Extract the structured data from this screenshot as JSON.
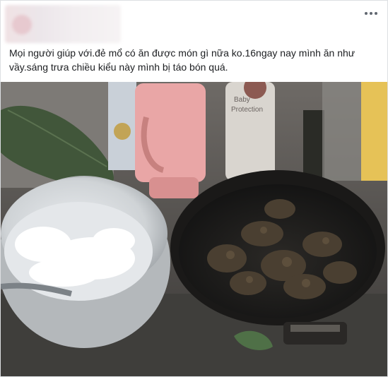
{
  "post": {
    "author_name": "",
    "text": "Mọi người giúp với.đẻ mổ có ăn được món gì nữa ko.16ngay nay mình ăn như vầy.sáng trưa chiều kiểu này mình bị táo bón quá.",
    "menu_icon": "more-horizontal-icon",
    "photo": {
      "description_icon": "food-photo",
      "bottle_label_line1": "Baby",
      "bottle_label_line2": "Protection"
    }
  }
}
